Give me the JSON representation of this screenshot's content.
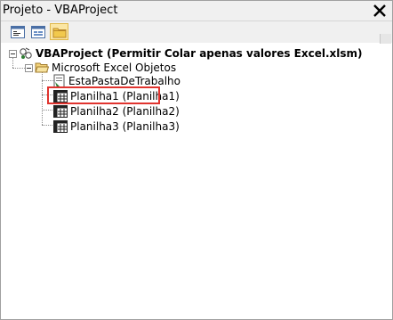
{
  "window": {
    "title": "Projeto - VBAProject",
    "close_label": "✕"
  },
  "toolbar": {
    "buttons": [
      {
        "name": "view-code",
        "icon": "code-view-icon",
        "active": false
      },
      {
        "name": "view-object",
        "icon": "form-view-icon",
        "active": false
      },
      {
        "name": "toggle-folders",
        "icon": "folder-icon",
        "active": true
      }
    ]
  },
  "tree": {
    "project": {
      "label": "VBAProject (Permitir Colar apenas valores Excel.xlsm)",
      "icon": "vba-project-icon",
      "expanded": true
    },
    "folder": {
      "label": "Microsoft Excel Objetos",
      "icon": "folder-open-icon",
      "expanded": true
    },
    "items": [
      {
        "label": "EstaPastaDeTrabalho",
        "icon": "workbook-icon",
        "selected": false
      },
      {
        "label": "Planilha1 (Planilha1)",
        "icon": "worksheet-icon",
        "selected": true
      },
      {
        "label": "Planilha2 (Planilha2)",
        "icon": "worksheet-icon",
        "selected": false
      },
      {
        "label": "Planilha3 (Planilha3)",
        "icon": "worksheet-icon",
        "selected": false
      }
    ]
  },
  "colors": {
    "highlight": "#e0342f",
    "toolbar_bg": "#f0f0f0",
    "active_button": "#fbe6a3"
  }
}
